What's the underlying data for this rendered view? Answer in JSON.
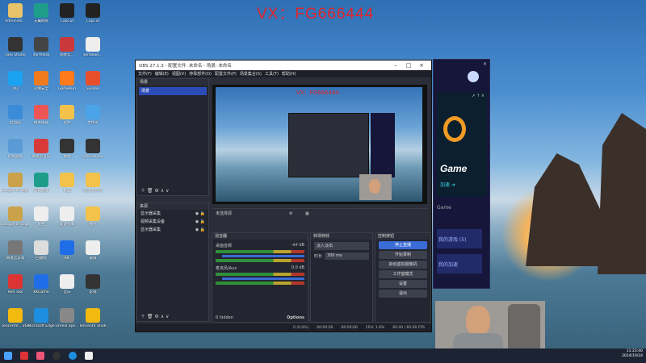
{
  "watermark": "VX：FG666444",
  "desktop_icons": [
    {
      "label": "Administr...",
      "color": "#e8c36a"
    },
    {
      "label": "天翼网盘",
      "color": "#1e9e8a"
    },
    {
      "label": "CapCut",
      "color": "#222"
    },
    {
      "label": "CapCut",
      "color": "#222"
    },
    {
      "label": "OBS Studio",
      "color": "#333"
    },
    {
      "label": "ifarmdisk",
      "color": "#444"
    },
    {
      "label": "网易云...",
      "color": "#c9383b"
    },
    {
      "label": "windows...",
      "color": "#eee"
    },
    {
      "label": "QQ",
      "color": "#1aa3f0"
    },
    {
      "label": "火绒安全",
      "color": "#f07b1f"
    },
    {
      "label": "GameRun",
      "color": "#ff7a1a"
    },
    {
      "label": "SGame",
      "color": "#e94f2b"
    },
    {
      "label": "此电脑",
      "color": "#3c8bd9"
    },
    {
      "label": "网易邮箱",
      "color": "#e55"
    },
    {
      "label": "软件",
      "color": "#f2c24b"
    },
    {
      "label": "文件夹",
      "color": "#4ba3e8"
    },
    {
      "label": "控制面板",
      "color": "#5b9bd5"
    },
    {
      "label": "网易云音乐",
      "color": "#d83a3a"
    },
    {
      "label": "视频",
      "color": "#333"
    },
    {
      "label": "OBS Studio",
      "color": "#333"
    },
    {
      "label": "League of Legends",
      "color": "#c9a24a"
    },
    {
      "label": "游戏加速",
      "color": "#1e9e8a"
    },
    {
      "label": "桌面",
      "color": "#f2c24b"
    },
    {
      "label": "新建文件夹",
      "color": "#f2c24b"
    },
    {
      "label": "League of Legends",
      "color": "#c9a24a"
    },
    {
      "label": "文档",
      "color": "#eee"
    },
    {
      "label": "新建文本",
      "color": "#eee"
    },
    {
      "label": "图片",
      "color": "#f2c24b"
    },
    {
      "label": "网易云游戏",
      "color": "#777"
    },
    {
      "label": "回收站",
      "color": "#ddd"
    },
    {
      "label": "KK",
      "color": "#1f6ee8"
    },
    {
      "label": "录屏",
      "color": "#eee"
    },
    {
      "label": "Red Tool",
      "color": "#d33"
    },
    {
      "label": "KKGame",
      "color": "#1f6ee8"
    },
    {
      "label": "音乐",
      "color": "#eee"
    },
    {
      "label": "影视",
      "color": "#333"
    },
    {
      "label": "TencentV... Studio ...",
      "color": "#f2b90f"
    },
    {
      "label": "Microsoft Edge",
      "color": "#1d8fe0"
    },
    {
      "label": "Unreal Spe...",
      "color": "#888"
    },
    {
      "label": "TencentV Studio",
      "color": "#f2b90f"
    }
  ],
  "obs": {
    "title": "OBS 27.1.3 - 配置文件: 未命名 - 场景: 未命名",
    "menu": [
      "文件(F)",
      "编辑(E)",
      "视图(V)",
      "停靠部件(D)",
      "配置文件(P)",
      "场景集合(S)",
      "工具(T)",
      "帮助(H)"
    ],
    "scenes_header": "场景",
    "scene_selected": "场景",
    "sources_header": "来源",
    "sources": [
      "显示器采集",
      "视频采集设备",
      "显示器采集"
    ],
    "preview_watermark": "VX：FG666444",
    "source_toolbar": "未选择源",
    "mixer_header": "混音器",
    "mixer_tracks": [
      {
        "name": "桌面音频",
        "db": "-inf dB"
      },
      {
        "name": "麦克风/Aux",
        "db": "0.0 dB"
      }
    ],
    "transitions_header": "转场特效",
    "transition_selected": "淡入淡出",
    "duration_label": "时长",
    "duration_value": "300 ms",
    "controls_header": "控制按钮",
    "controls": [
      "停止直播",
      "开始录制",
      "启动虚拟摄像机",
      "工作室模式",
      "设置",
      "退出"
    ],
    "hidden_label": "0 hidden",
    "options_label": "Options",
    "status": [
      "0 (0.0%)",
      "00:00:00",
      "00:00:00",
      "CPU: 1.6%",
      "60.00 / 60.00 FPS"
    ]
  },
  "game": {
    "title_icon": "game-app-icon",
    "banner_word": "Game",
    "banner_sub": "加速 ➜",
    "label": "Game",
    "items": [
      "我的游戏 (5)",
      "我的加速"
    ]
  },
  "taskbar": {
    "time": "11:23:40",
    "date": "2024/10/24"
  }
}
